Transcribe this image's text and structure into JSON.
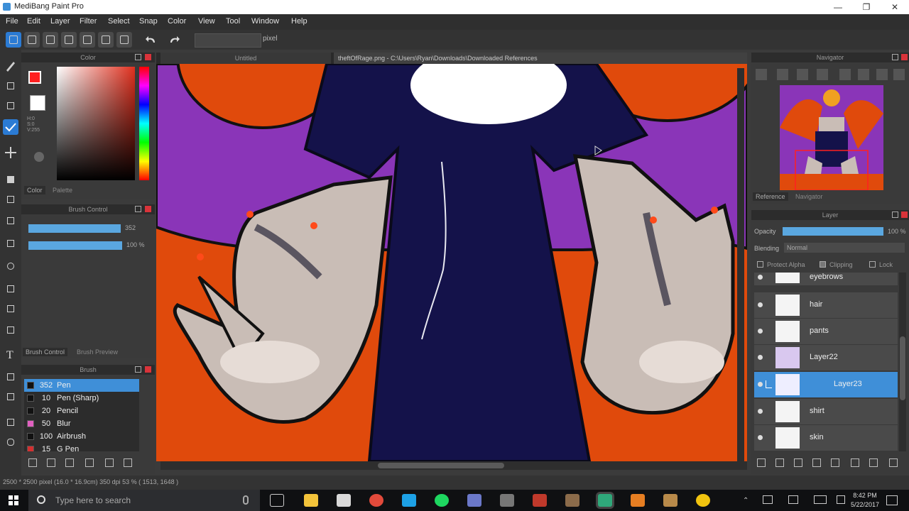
{
  "window": {
    "title": "MediBang Paint Pro",
    "controls": {
      "minimize": "—",
      "maximize": "❐",
      "close": "✕"
    }
  },
  "menu": [
    "File",
    "Edit",
    "Layer",
    "Filter",
    "Select",
    "Snap",
    "Color",
    "View",
    "Tool",
    "Window",
    "Help"
  ],
  "toolbar": {
    "unit_label": "pixel"
  },
  "panels": {
    "color": {
      "title": "Color",
      "tabs": [
        "Color",
        "Palette"
      ],
      "primary_color": "#ff2020",
      "hsv_readout": [
        "H:0",
        "S:0",
        "V:255"
      ]
    },
    "brush_control": {
      "title": "Brush Control",
      "size_value": "352",
      "opacity_value": "100 %",
      "tabs": [
        "Brush Control",
        "Brush Preview"
      ]
    },
    "brush": {
      "title": "Brush",
      "items": [
        {
          "size": "352",
          "name": "Pen",
          "color": "#111111"
        },
        {
          "size": "10",
          "name": "Pen (Sharp)",
          "color": "#111111"
        },
        {
          "size": "20",
          "name": "Pencil",
          "color": "#111111"
        },
        {
          "size": "50",
          "name": "Blur",
          "color": "#e060c0"
        },
        {
          "size": "100",
          "name": "Airbrush",
          "color": "#111111"
        },
        {
          "size": "15",
          "name": "G Pen",
          "color": "#d33030"
        }
      ]
    },
    "navigator": {
      "title": "Navigator",
      "tabs": [
        "Reference",
        "Navigator"
      ]
    },
    "layer": {
      "title": "Layer",
      "opacity_label": "Opacity",
      "opacity_value": "100 %",
      "blending_label": "Blending",
      "blending_value": "Normal",
      "protect_alpha": "Protect Alpha",
      "clipping": "Clipping",
      "lock": "Lock",
      "items": [
        {
          "name": "eyebrows",
          "selected": false
        },
        {
          "name": "hair",
          "selected": false
        },
        {
          "name": "pants",
          "selected": false
        },
        {
          "name": "Layer22",
          "selected": false
        },
        {
          "name": "Layer23",
          "selected": true
        },
        {
          "name": "shirt",
          "selected": false
        },
        {
          "name": "skin",
          "selected": false
        }
      ]
    }
  },
  "canvas": {
    "left_tab_label": "Untitled",
    "document_path": "theftOfRage.png - C:\\Users\\Ryan\\Downloads\\Downloaded References"
  },
  "status": {
    "text": "2500 * 2500 pixel  (16.0 * 16.9cm)  350 dpi  53 %  ( 1513, 1648 )"
  },
  "taskbar": {
    "search_placeholder": "Type here to search",
    "time": "8:42 PM",
    "date": "5/22/2017"
  }
}
